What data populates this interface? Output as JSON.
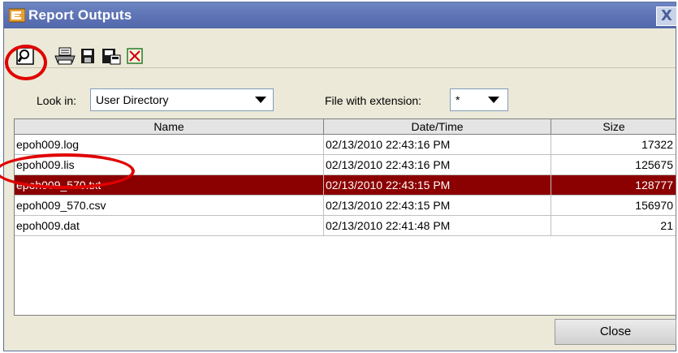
{
  "window": {
    "title": "Report Outputs",
    "close_glyph": "X"
  },
  "toolbar": {
    "buttons": [
      {
        "name": "view-icon",
        "interactable": true
      },
      {
        "name": "print-icon",
        "interactable": true
      },
      {
        "name": "save-icon",
        "interactable": true
      },
      {
        "name": "save-as-icon",
        "interactable": true
      },
      {
        "name": "delete-icon",
        "interactable": true
      }
    ]
  },
  "filters": {
    "look_in_label": "Look in:",
    "look_in_value": "User Directory",
    "extension_label": "File with extension:",
    "extension_value": "*"
  },
  "table": {
    "headers": [
      "Name",
      "Date/Time",
      "Size"
    ],
    "rows": [
      {
        "name": "epoh009.log",
        "datetime": "02/13/2010 22:43:16 PM",
        "size": "17322",
        "selected": false
      },
      {
        "name": "epoh009.lis",
        "datetime": "02/13/2010 22:43:16 PM",
        "size": "125675",
        "selected": false
      },
      {
        "name": "epoh009_570.txt",
        "datetime": "02/13/2010 22:43:15 PM",
        "size": "128777",
        "selected": true
      },
      {
        "name": "epoh009_570.csv",
        "datetime": "02/13/2010 22:43:15 PM",
        "size": "156970",
        "selected": false
      },
      {
        "name": "epoh009.dat",
        "datetime": "02/13/2010 22:41:48 PM",
        "size": "21",
        "selected": false
      }
    ]
  },
  "footer": {
    "close_label": "Close"
  },
  "colors": {
    "titlebar": "#5f75b6",
    "selection": "#8b0000",
    "annotation": "#e00000"
  }
}
